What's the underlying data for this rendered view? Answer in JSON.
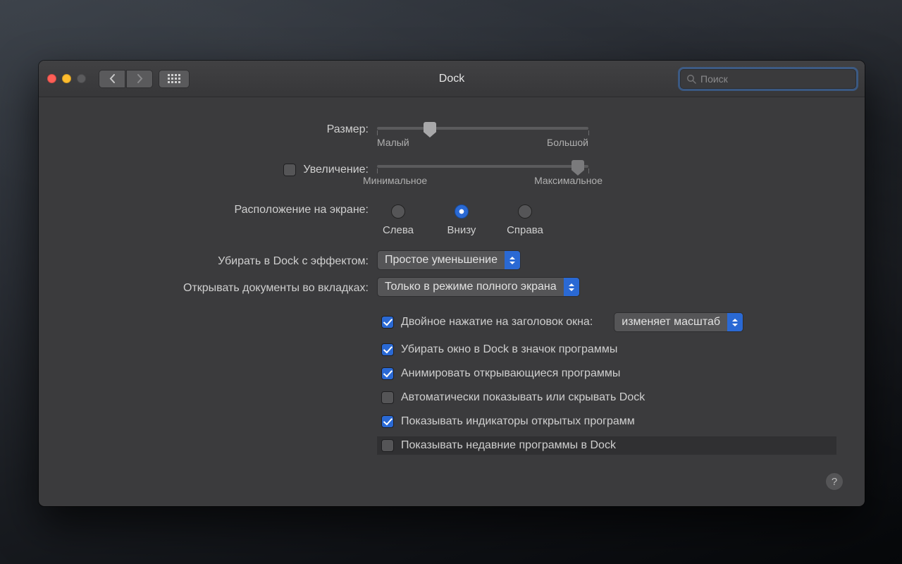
{
  "window": {
    "title": "Dock",
    "search_placeholder": "Поиск"
  },
  "size": {
    "label": "Размер:",
    "value_pct": 25,
    "min_label": "Малый",
    "max_label": "Большой"
  },
  "magnification": {
    "label": "Увеличение:",
    "checked": false,
    "value_pct": 95,
    "min_label": "Минимальное",
    "max_label": "Максимальное"
  },
  "position": {
    "label": "Расположение на экране:",
    "options": {
      "left": "Слева",
      "bottom": "Внизу",
      "right": "Справа"
    },
    "selected": "bottom"
  },
  "minimize_effect": {
    "label": "Убирать в Dock с эффектом:",
    "value": "Простое уменьшение"
  },
  "open_tabs": {
    "label": "Открывать документы во вкладках:",
    "value": "Только в режиме полного экрана"
  },
  "double_click": {
    "checked": true,
    "label": "Двойное нажатие на заголовок окна:",
    "value": "изменяет масштаб"
  },
  "checks": {
    "minimize_to_app": {
      "checked": true,
      "label": "Убирать окно в Dock в значок программы"
    },
    "animate_open": {
      "checked": true,
      "label": "Анимировать открывающиеся программы"
    },
    "auto_hide": {
      "checked": false,
      "label": "Автоматически показывать или скрывать Dock"
    },
    "indicators": {
      "checked": true,
      "label": "Показывать индикаторы открытых программ"
    },
    "recents": {
      "checked": false,
      "label": "Показывать недавние программы в Dock"
    }
  },
  "help": "?"
}
